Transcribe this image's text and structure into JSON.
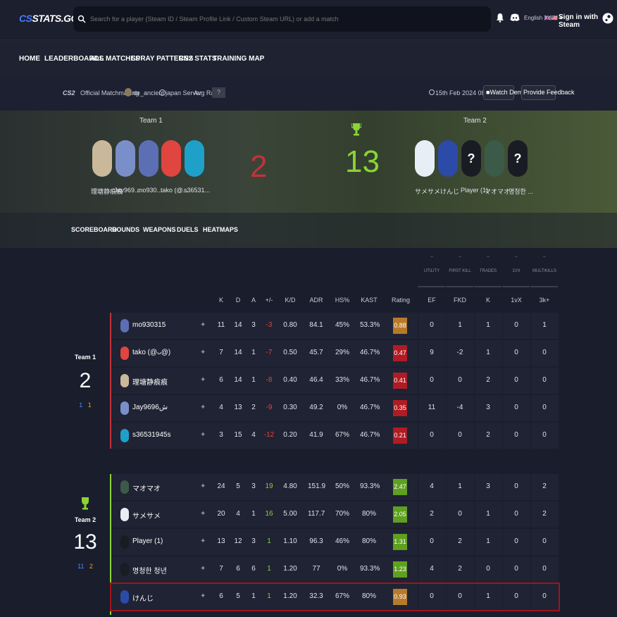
{
  "header": {
    "logo_a": "CS",
    "logo_b": "STATS.GG",
    "search_placeholder": "Search for a player (Steam ID / Steam Profile Link / Custom Steam URL) or add a match",
    "lang": "English 🇬🇧🇺🇸 ▾",
    "signin": "Sign in with Steam"
  },
  "nav": [
    "HOME",
    "LEADERBOARDS",
    "ALL MATCHES",
    "SPRAY PATTERNS",
    "CS2 STATS",
    "TRAINING MAP"
  ],
  "match": {
    "game": "CS2",
    "mode": "Official Matchmaking",
    "map": "de_ancient",
    "server": "japan Server",
    "avg_rank_label": "Avg Rank",
    "avg_rank": "?",
    "date": "15th Feb 2024 08:36:43",
    "watch_demo": "Watch Demo",
    "feedback": "Provide Feedback"
  },
  "team1": {
    "label": "Team 1",
    "score": "2",
    "players": [
      "理塘静痕痕",
      "Jay969...",
      "mo930...",
      "tako (@...",
      "s36531..."
    ],
    "side_a": "1",
    "side_b": "1",
    "colors": [
      "#c9b89a",
      "#7a8fc9",
      "#5c6fb5",
      "#e0453f",
      "#1fa0c8"
    ]
  },
  "team2": {
    "label": "Team 2",
    "score": "13",
    "players": [
      "サメサメ",
      "けんじ",
      "Player (1)",
      "マオマオ",
      "명청한 ..."
    ],
    "side_a": "11",
    "side_b": "2",
    "colors": [
      "#e8eef6",
      "#2c4aa8",
      "#1a1c24",
      "#3c5a48",
      "#1a1c24"
    ]
  },
  "tabs": [
    "SCOREBOARD",
    "ROUNDS",
    "WEAPONS",
    "DUELS",
    "HEATMAPS"
  ],
  "groups": [
    {
      "dash": "--",
      "label": "UTILITY"
    },
    {
      "dash": "--",
      "label": "FIRST KILL"
    },
    {
      "dash": "--",
      "label": "TRADES"
    },
    {
      "dash": "--",
      "label": "1VX"
    },
    {
      "dash": "--",
      "label": "MULTIKILLS"
    }
  ],
  "columns": [
    "K",
    "D",
    "A",
    "+/-",
    "K/D",
    "ADR",
    "HS%",
    "KAST",
    "Rating",
    "EF",
    "FKD",
    "K",
    "1vX",
    "3k+"
  ],
  "team1_rows": [
    {
      "name": "mo930315",
      "k": "11",
      "d": "14",
      "a": "3",
      "pm": "-3",
      "kd": "0.80",
      "adr": "84.1",
      "hs": "45%",
      "kast": "53.3%",
      "rating": "0.88",
      "rcolor": "#b87a2a",
      "ef": "0",
      "fkd": "1",
      "tk": "1",
      "v": "0",
      "mk": "1",
      "av": "#5c6fb5"
    },
    {
      "name": "tako (@ᴗ@)",
      "k": "7",
      "d": "14",
      "a": "1",
      "pm": "-7",
      "kd": "0.50",
      "adr": "45.7",
      "hs": "29%",
      "kast": "46.7%",
      "rating": "0.47",
      "rcolor": "#b01c24",
      "ef": "9",
      "fkd": "-2",
      "tk": "1",
      "v": "0",
      "mk": "0",
      "av": "#e0453f"
    },
    {
      "name": "理塘静痕痕",
      "k": "6",
      "d": "14",
      "a": "1",
      "pm": "-8",
      "kd": "0.40",
      "adr": "46.4",
      "hs": "33%",
      "kast": "46.7%",
      "rating": "0.41",
      "rcolor": "#b01c24",
      "ef": "0",
      "fkd": "0",
      "tk": "2",
      "v": "0",
      "mk": "0",
      "av": "#c9b89a"
    },
    {
      "name": "Jay9696ش",
      "k": "4",
      "d": "13",
      "a": "2",
      "pm": "-9",
      "kd": "0.30",
      "adr": "49.2",
      "hs": "0%",
      "kast": "46.7%",
      "rating": "0.35",
      "rcolor": "#b01c24",
      "ef": "11",
      "fkd": "-4",
      "tk": "3",
      "v": "0",
      "mk": "0",
      "av": "#7a8fc9"
    },
    {
      "name": "s36531945s",
      "k": "3",
      "d": "15",
      "a": "4",
      "pm": "-12",
      "kd": "0.20",
      "adr": "41.9",
      "hs": "67%",
      "kast": "46.7%",
      "rating": "0.21",
      "rcolor": "#b01c24",
      "ef": "0",
      "fkd": "0",
      "tk": "2",
      "v": "0",
      "mk": "0",
      "av": "#1fa0c8"
    }
  ],
  "team2_rows": [
    {
      "name": "マオマオ",
      "k": "24",
      "d": "5",
      "a": "3",
      "pm": "19",
      "kd": "4.80",
      "adr": "151.9",
      "hs": "50%",
      "kast": "93.3%",
      "rating": "2.47",
      "rcolor": "#5fa021",
      "ef": "4",
      "fkd": "1",
      "tk": "3",
      "v": "0",
      "mk": "2",
      "av": "#3c5a48"
    },
    {
      "name": "サメサメ",
      "k": "20",
      "d": "4",
      "a": "1",
      "pm": "16",
      "kd": "5.00",
      "adr": "117.7",
      "hs": "70%",
      "kast": "80%",
      "rating": "2.05",
      "rcolor": "#5fa021",
      "ef": "2",
      "fkd": "0",
      "tk": "1",
      "v": "0",
      "mk": "2",
      "av": "#e8eef6"
    },
    {
      "name": "Player (1)",
      "k": "13",
      "d": "12",
      "a": "3",
      "pm": "1",
      "kd": "1.10",
      "adr": "96.3",
      "hs": "46%",
      "kast": "80%",
      "rating": "1.31",
      "rcolor": "#5fa021",
      "ef": "0",
      "fkd": "2",
      "tk": "1",
      "v": "0",
      "mk": "0",
      "av": "#1a1c24"
    },
    {
      "name": "명청한 청년",
      "k": "7",
      "d": "6",
      "a": "6",
      "pm": "1",
      "kd": "1.20",
      "adr": "77",
      "hs": "0%",
      "kast": "93.3%",
      "rating": "1.23",
      "rcolor": "#5fa021",
      "ef": "4",
      "fkd": "2",
      "tk": "0",
      "v": "0",
      "mk": "0",
      "av": "#1a1c24"
    },
    {
      "name": "けんじ",
      "k": "6",
      "d": "5",
      "a": "1",
      "pm": "1",
      "kd": "1.20",
      "adr": "32.3",
      "hs": "67%",
      "kast": "80%",
      "rating": "0.93",
      "rcolor": "#b87a2a",
      "ef": "0",
      "fkd": "0",
      "tk": "1",
      "v": "0",
      "mk": "0",
      "av": "#2c4aa8"
    }
  ],
  "colors": {
    "loss": "#c2323c",
    "win": "#8bd435",
    "side_a": "#4a8cff",
    "side_b": "#f0a030",
    "highlight": "#a0141c"
  }
}
